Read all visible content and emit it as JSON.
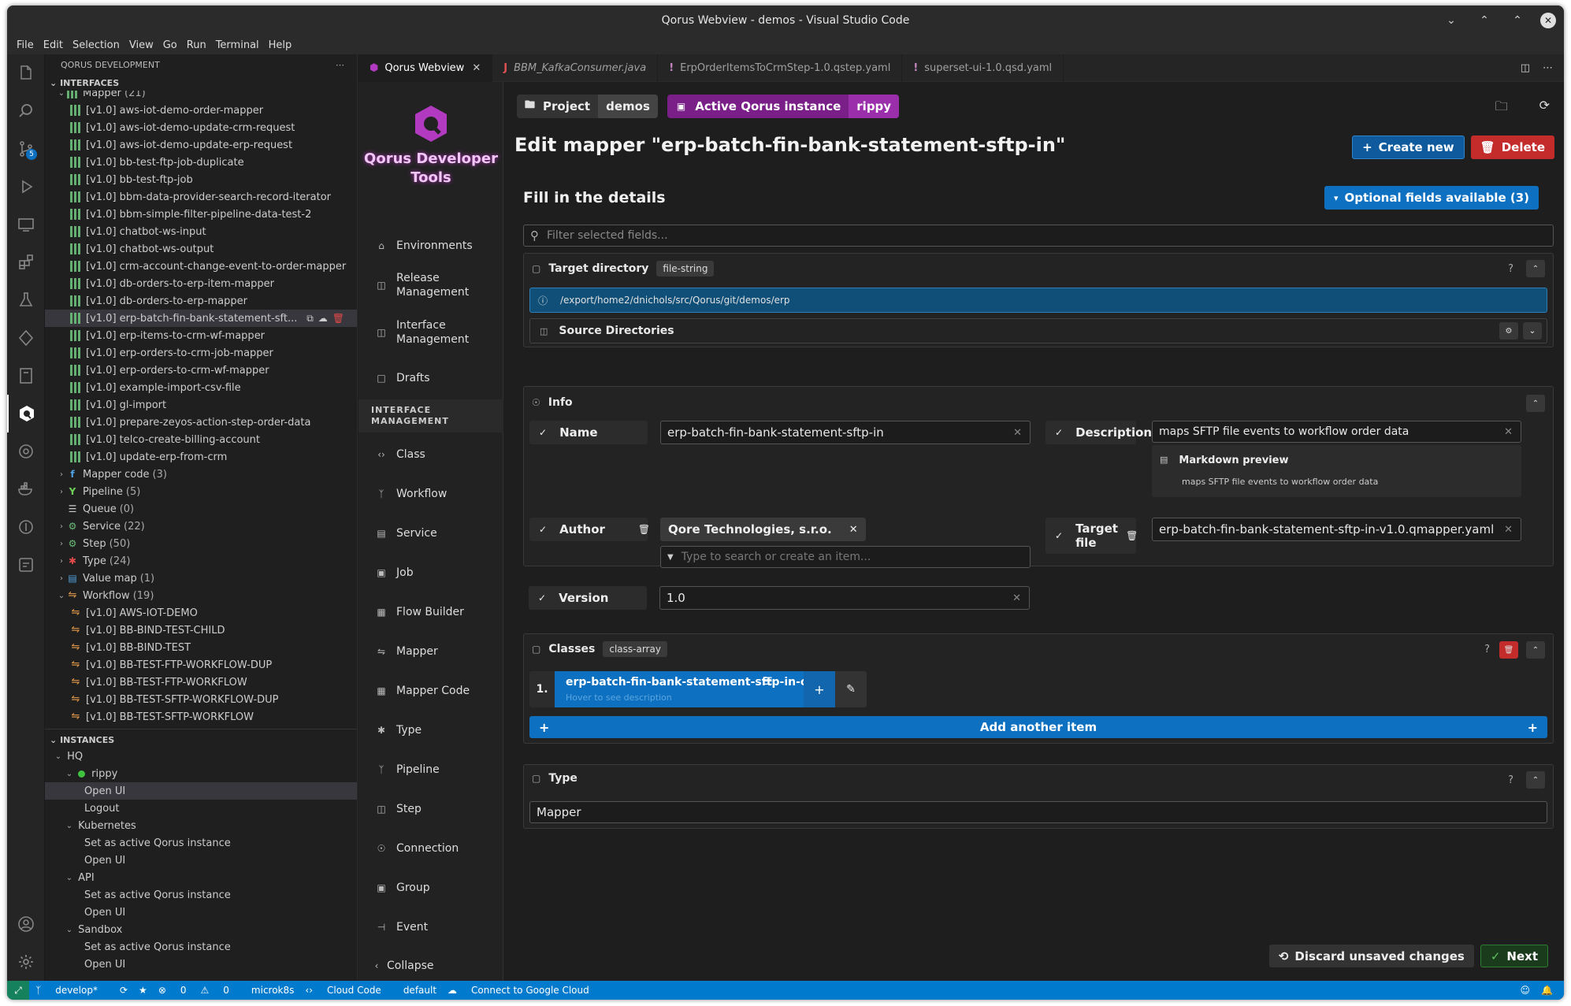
{
  "window": {
    "title": "Qorus Webview - demos - Visual Studio Code"
  },
  "menu": [
    "File",
    "Edit",
    "Selection",
    "View",
    "Go",
    "Run",
    "Terminal",
    "Help"
  ],
  "sidebar": {
    "title": "QORUS DEVELOPMENT",
    "interfaces_header": "INTERFACES",
    "mapper_group": "Mapper",
    "mapper_count": "(21)",
    "mappers": [
      "[v1.0]  aws-iot-demo-order-mapper",
      "[v1.0]  aws-iot-demo-update-crm-request",
      "[v1.0]  aws-iot-demo-update-erp-request",
      "[v1.0]  bb-test-ftp-job-duplicate",
      "[v1.0]  bb-test-ftp-job",
      "[v1.0]  bbm-data-provider-search-record-iterator",
      "[v1.0]  bbm-simple-filter-pipeline-data-test-2",
      "[v1.0]  chatbot-ws-input",
      "[v1.0]  chatbot-ws-output",
      "[v1.0]  crm-account-change-event-to-order-mapper",
      "[v1.0]  db-orders-to-erp-item-mapper",
      "[v1.0]  db-orders-to-erp-mapper",
      "[v1.0]  erp-batch-fin-bank-statement-sft...",
      "[v1.0]  erp-items-to-crm-wf-mapper",
      "[v1.0]  erp-orders-to-crm-job-mapper",
      "[v1.0]  erp-orders-to-crm-wf-mapper",
      "[v1.0]  example-import-csv-file",
      "[v1.0]  gl-import",
      "[v1.0]  prepare-zeyos-action-step-order-data",
      "[v1.0]  telco-create-billing-account",
      "[v1.0]  update-erp-from-crm"
    ],
    "groups": [
      {
        "label": "Mapper code",
        "count": "(3)",
        "icon": "mapper-code-icon",
        "color": "#4fa3e0"
      },
      {
        "label": "Pipeline",
        "count": "(5)",
        "icon": "pipeline-icon",
        "color": "#6fcf5a"
      },
      {
        "label": "Queue",
        "count": "(0)",
        "icon": "queue-icon",
        "color": "#cccccc"
      },
      {
        "label": "Service",
        "count": "(22)",
        "icon": "service-icon",
        "color": "#6bbf7a"
      },
      {
        "label": "Step",
        "count": "(50)",
        "icon": "step-icon",
        "color": "#6bbf7a"
      },
      {
        "label": "Type",
        "count": "(24)",
        "icon": "type-icon",
        "color": "#e04a4a"
      },
      {
        "label": "Value map",
        "count": "(1)",
        "icon": "value-map-icon",
        "color": "#4fa3e0"
      }
    ],
    "workflow_group": "Workflow",
    "workflow_count": "(19)",
    "workflows": [
      "[v1.0]  AWS-IOT-DEMO",
      "[v1.0]  BB-BIND-TEST-CHILD",
      "[v1.0]  BB-BIND-TEST",
      "[v1.0]  BB-TEST-FTP-WORKFLOW-DUP",
      "[v1.0]  BB-TEST-FTP-WORKFLOW",
      "[v1.0]  BB-TEST-SFTP-WORKFLOW-DUP",
      "[v1.0]  BB-TEST-SFTP-WORKFLOW"
    ],
    "instances_header": "INSTANCES",
    "hq": "HQ",
    "rippy": "rippy",
    "open_ui": "Open UI",
    "logout": "Logout",
    "kubernetes": "Kubernetes",
    "set_active": "Set as active Qorus instance",
    "api": "API",
    "sandbox": "Sandbox"
  },
  "tabs": [
    {
      "label": "Qorus Webview",
      "active": true
    },
    {
      "label": "BBM_KafkaConsumer.java",
      "active": false
    },
    {
      "label": "ErpOrderItemsToCrmStep-1.0.qstep.yaml",
      "active": false
    },
    {
      "label": "superset-ui-1.0.qsd.yaml",
      "active": false
    }
  ],
  "nav": {
    "logo_title_1": "Qorus Developer",
    "logo_title_2": "Tools",
    "top_items": [
      "Environments",
      "Release Management",
      "Interface Management",
      "Drafts"
    ],
    "section_line1": "INTERFACE",
    "section_line2": "MANAGEMENT",
    "items": [
      "Class",
      "Workflow",
      "Service",
      "Job",
      "Flow Builder",
      "Mapper",
      "Mapper Code",
      "Type",
      "Pipeline",
      "Step",
      "Connection",
      "Group",
      "Event"
    ],
    "collapse": "Collapse"
  },
  "header": {
    "project_label": "Project",
    "project_value": "demos",
    "instance_label": "Active Qorus instance",
    "instance_value": "rippy"
  },
  "page": {
    "title": "Edit mapper \"erp-batch-fin-bank-statement-sftp-in\"",
    "create_new": "Create new",
    "delete": "Delete",
    "subtitle": "Fill in the details",
    "optional": "Optional fields available (3)",
    "filter_placeholder": "Filter selected fields..."
  },
  "target": {
    "title": "Target directory",
    "tag": "file-string",
    "path": "/export/home2/dnichols/src/Qorus/git/demos/erp",
    "source_dirs": "Source Directories"
  },
  "info": {
    "title": "Info",
    "name_label": "Name",
    "name_value": "erp-batch-fin-bank-statement-sftp-in",
    "desc_label": "Description",
    "desc_value": "maps SFTP file events to workflow order data",
    "md_title": "Markdown preview",
    "md_text": "maps SFTP file events to workflow order data",
    "author_label": "Author",
    "author_value": "Qore Technologies, s.r.o.",
    "author_placeholder": "Type to search or create an item...",
    "target_label_1": "Target",
    "target_label_2": "file",
    "target_value": "erp-batch-fin-bank-statement-sftp-in-v1.0.qmapper.yaml",
    "version_label": "Version",
    "version_value": "1.0"
  },
  "classes": {
    "title": "Classes",
    "tag": "class-array",
    "index": "1.",
    "item": "erp-batch-fin-bank-statement-sftp-in-code",
    "hover": "Hover to see description",
    "add": "Add another item"
  },
  "type": {
    "title": "Type",
    "value": "Mapper"
  },
  "footer": {
    "discard": "Discard unsaved changes",
    "next": "Next"
  },
  "status": {
    "branch": "develop*",
    "problems": "0",
    "warnings": "0",
    "cluster": "microk8s",
    "cloud_code": "Cloud Code",
    "namespace": "default",
    "google": "Connect to Google Cloud"
  },
  "colors": {
    "accent": "#0e70c0",
    "qorus_purple": "#7a1f88",
    "delete_red": "#c42b2b",
    "next_green": "#2f7d32",
    "status_blue": "#007acc"
  }
}
